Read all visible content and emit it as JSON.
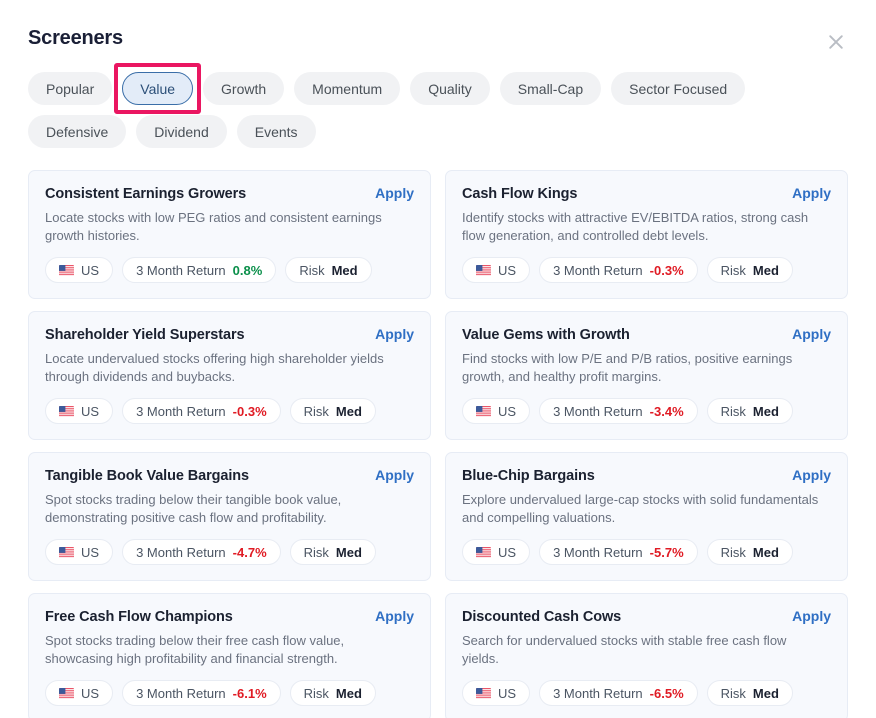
{
  "header": {
    "title": "Screeners",
    "close_icon": "close-icon"
  },
  "tabs": [
    {
      "label": "Popular",
      "selected": false,
      "highlighted": false
    },
    {
      "label": "Value",
      "selected": true,
      "highlighted": true
    },
    {
      "label": "Growth",
      "selected": false,
      "highlighted": false
    },
    {
      "label": "Momentum",
      "selected": false,
      "highlighted": false
    },
    {
      "label": "Quality",
      "selected": false,
      "highlighted": false
    },
    {
      "label": "Small-Cap",
      "selected": false,
      "highlighted": false
    },
    {
      "label": "Sector Focused",
      "selected": false,
      "highlighted": false
    },
    {
      "label": "Defensive",
      "selected": false,
      "highlighted": false
    },
    {
      "label": "Dividend",
      "selected": false,
      "highlighted": false
    },
    {
      "label": "Events",
      "selected": false,
      "highlighted": false
    }
  ],
  "labels": {
    "apply": "Apply",
    "return_label": "3 Month Return",
    "risk_label": "Risk",
    "region": "US",
    "flag_icon": "us-flag-icon"
  },
  "colors": {
    "accent_blue": "#2f6fc4",
    "positive_green": "#0a8f4a",
    "negative_red": "#e01b24",
    "highlight_pink": "#ea1661",
    "card_bg": "#f7f9fd",
    "tab_bg": "#f1f2f4",
    "tab_selected_bg": "#e3ecf8"
  },
  "cards": [
    {
      "title": "Consistent Earnings Growers",
      "description": "Locate stocks with low PEG ratios and consistent earnings growth histories.",
      "region": "US",
      "return_label": "3 Month Return",
      "return_value": "0.8%",
      "return_sign": "pos",
      "risk_label": "Risk",
      "risk_value": "Med",
      "apply": "Apply"
    },
    {
      "title": "Cash Flow Kings",
      "description": "Identify stocks with attractive EV/EBITDA ratios, strong cash flow generation, and controlled debt levels.",
      "region": "US",
      "return_label": "3 Month Return",
      "return_value": "-0.3%",
      "return_sign": "neg",
      "risk_label": "Risk",
      "risk_value": "Med",
      "apply": "Apply"
    },
    {
      "title": "Shareholder Yield Superstars",
      "description": "Locate undervalued stocks offering high shareholder yields through dividends and buybacks.",
      "region": "US",
      "return_label": "3 Month Return",
      "return_value": "-0.3%",
      "return_sign": "neg",
      "risk_label": "Risk",
      "risk_value": "Med",
      "apply": "Apply"
    },
    {
      "title": "Value Gems with Growth",
      "description": "Find stocks with low P/E and P/B ratios, positive earnings growth, and healthy profit margins.",
      "region": "US",
      "return_label": "3 Month Return",
      "return_value": "-3.4%",
      "return_sign": "neg",
      "risk_label": "Risk",
      "risk_value": "Med",
      "apply": "Apply"
    },
    {
      "title": "Tangible Book Value Bargains",
      "description": "Spot stocks trading below their tangible book value, demonstrating positive cash flow and profitability.",
      "region": "US",
      "return_label": "3 Month Return",
      "return_value": "-4.7%",
      "return_sign": "neg",
      "risk_label": "Risk",
      "risk_value": "Med",
      "apply": "Apply"
    },
    {
      "title": "Blue-Chip Bargains",
      "description": "Explore undervalued large-cap stocks with solid fundamentals and compelling valuations.",
      "region": "US",
      "return_label": "3 Month Return",
      "return_value": "-5.7%",
      "return_sign": "neg",
      "risk_label": "Risk",
      "risk_value": "Med",
      "apply": "Apply"
    },
    {
      "title": "Free Cash Flow Champions",
      "description": "Spot stocks trading below their free cash flow value, showcasing high profitability and financial strength.",
      "region": "US",
      "return_label": "3 Month Return",
      "return_value": "-6.1%",
      "return_sign": "neg",
      "risk_label": "Risk",
      "risk_value": "Med",
      "apply": "Apply"
    },
    {
      "title": "Discounted Cash Cows",
      "description": "Search for undervalued stocks with stable free cash flow yields.",
      "region": "US",
      "return_label": "3 Month Return",
      "return_value": "-6.5%",
      "return_sign": "neg",
      "risk_label": "Risk",
      "risk_value": "Med",
      "apply": "Apply"
    }
  ]
}
